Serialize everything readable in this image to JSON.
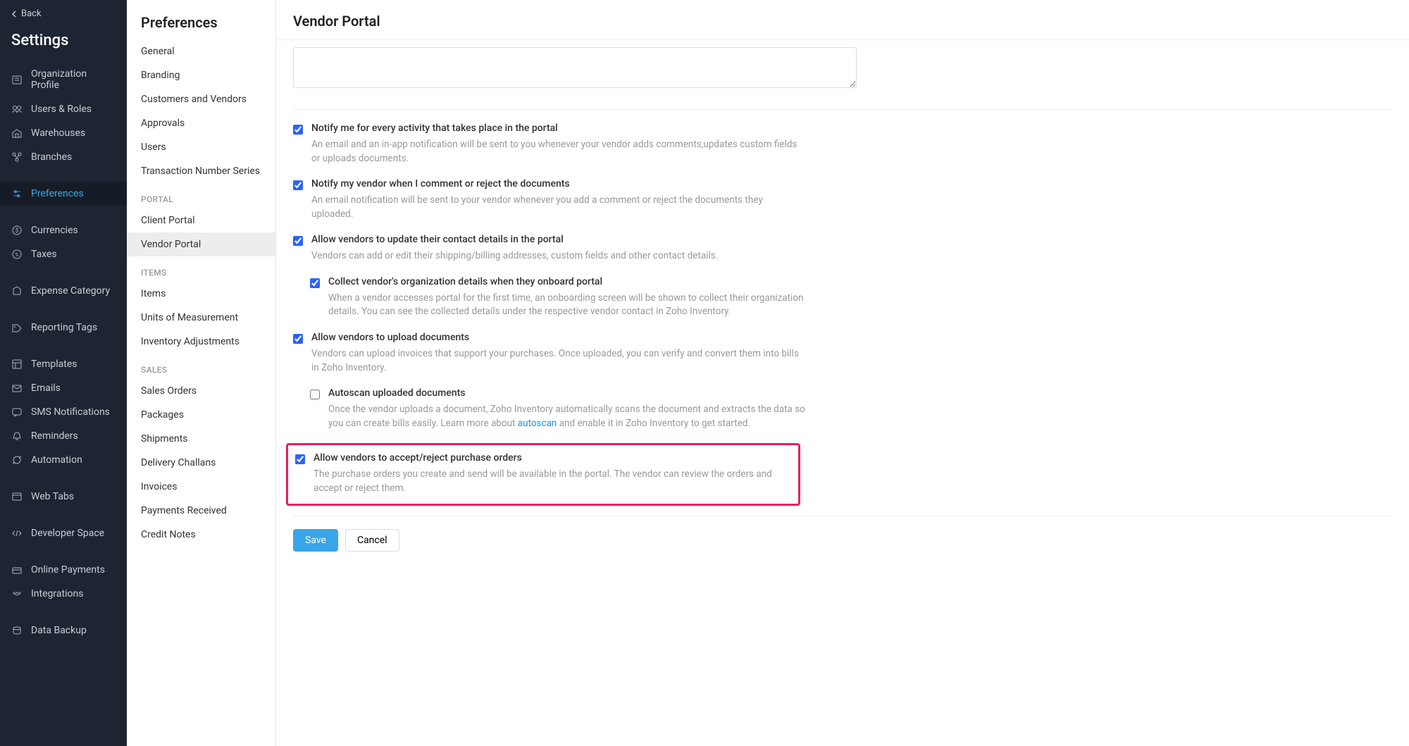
{
  "left_sidebar": {
    "back": "Back",
    "title": "Settings",
    "items": [
      {
        "label": "Organization Profile",
        "icon": "org"
      },
      {
        "label": "Users & Roles",
        "icon": "users"
      },
      {
        "label": "Warehouses",
        "icon": "warehouse"
      },
      {
        "label": "Branches",
        "icon": "branches"
      },
      {
        "label": "Preferences",
        "icon": "prefs",
        "active": true
      },
      {
        "label": "Currencies",
        "icon": "currency"
      },
      {
        "label": "Taxes",
        "icon": "taxes"
      },
      {
        "label": "Expense Category",
        "icon": "expense"
      },
      {
        "label": "Reporting Tags",
        "icon": "tags"
      },
      {
        "label": "Templates",
        "icon": "templates"
      },
      {
        "label": "Emails",
        "icon": "emails"
      },
      {
        "label": "SMS Notifications",
        "icon": "sms"
      },
      {
        "label": "Reminders",
        "icon": "reminders"
      },
      {
        "label": "Automation",
        "icon": "automation"
      },
      {
        "label": "Web Tabs",
        "icon": "webtabs"
      },
      {
        "label": "Developer Space",
        "icon": "dev"
      },
      {
        "label": "Online Payments",
        "icon": "payments"
      },
      {
        "label": "Integrations",
        "icon": "integrations"
      },
      {
        "label": "Data Backup",
        "icon": "backup"
      }
    ]
  },
  "mid_sidebar": {
    "title": "Preferences",
    "sections": [
      {
        "header": null,
        "items": [
          "General",
          "Branding",
          "Customers and Vendors",
          "Approvals",
          "Users",
          "Transaction Number Series"
        ]
      },
      {
        "header": "PORTAL",
        "items": [
          "Client Portal",
          "Vendor Portal"
        ],
        "active_index": 1
      },
      {
        "header": "ITEMS",
        "items": [
          "Items",
          "Units of Measurement",
          "Inventory Adjustments"
        ]
      },
      {
        "header": "SALES",
        "items": [
          "Sales Orders",
          "Packages",
          "Shipments",
          "Delivery Challans",
          "Invoices",
          "Payments Received",
          "Credit Notes"
        ]
      }
    ]
  },
  "main": {
    "title": "Vendor Portal",
    "options": [
      {
        "checked": true,
        "label": "Notify me for every activity that takes place in the portal",
        "desc": "An email and an in-app notification will be sent to you whenever your vendor adds comments,updates custom fields or uploads documents."
      },
      {
        "checked": true,
        "label": "Notify my vendor when I comment or reject the documents",
        "desc": "An email notification will be sent to your vendor whenever you add a comment or reject the documents they uploaded."
      },
      {
        "checked": true,
        "label": "Allow vendors to update their contact details in the portal",
        "desc": "Vendors can add or edit their shipping/billing addresses, custom fields and other contact details."
      },
      {
        "checked": true,
        "nested": true,
        "label": "Collect vendor's organization details when they onboard portal",
        "desc": "When a vendor accesses portal for the first time, an onboarding screen will be shown to collect their organization details. You can see the collected details under the respective vendor contact in Zoho Inventory."
      },
      {
        "checked": true,
        "label": "Allow vendors to upload documents",
        "desc": "Vendors can upload invoices that support your purchases. Once uploaded, you can verify and convert them into bills in Zoho Inventory."
      },
      {
        "checked": false,
        "nested": true,
        "label": "Autoscan uploaded documents",
        "desc_pre": "Once the vendor uploads a document, Zoho Inventory automatically scans the document and extracts the data so you can create bills easily. Learn more about ",
        "link": "autoscan",
        "desc_post": " and enable it in Zoho Inventory to get started."
      },
      {
        "checked": true,
        "highlight": true,
        "label": "Allow vendors to accept/reject purchase orders",
        "desc": "The purchase orders you create and send will be available in the portal. The vendor can review the orders and accept or reject them."
      }
    ],
    "save": "Save",
    "cancel": "Cancel"
  }
}
